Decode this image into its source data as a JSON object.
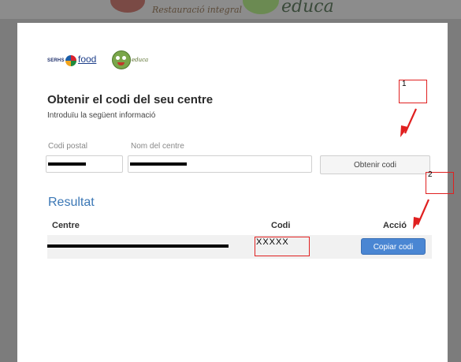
{
  "background": {
    "brand_text": "Restauració integral",
    "brand_educa": "educa"
  },
  "brand": {
    "serhs": "SERHS",
    "food": "food",
    "educa": "educa"
  },
  "page": {
    "title": "Obtenir el codi del seu centre",
    "subtitle": "Introduïu la següent informació"
  },
  "form": {
    "postal_label": "Codi postal",
    "postal_value": "",
    "centre_label": "Nom del centre",
    "centre_value": "",
    "get_button": "Obtenir codi"
  },
  "results": {
    "title": "Resultat",
    "col_centre": "Centre",
    "col_code": "Codi",
    "col_action": "Acció",
    "rows": [
      {
        "centre": "",
        "code": "XXXXX",
        "action": "Copiar codi"
      }
    ]
  },
  "annotations": {
    "step1": "1",
    "step2": "2",
    "color": "#e02020"
  },
  "colors": {
    "accent": "#3b77b5",
    "primary_button": "#4a86d3"
  }
}
